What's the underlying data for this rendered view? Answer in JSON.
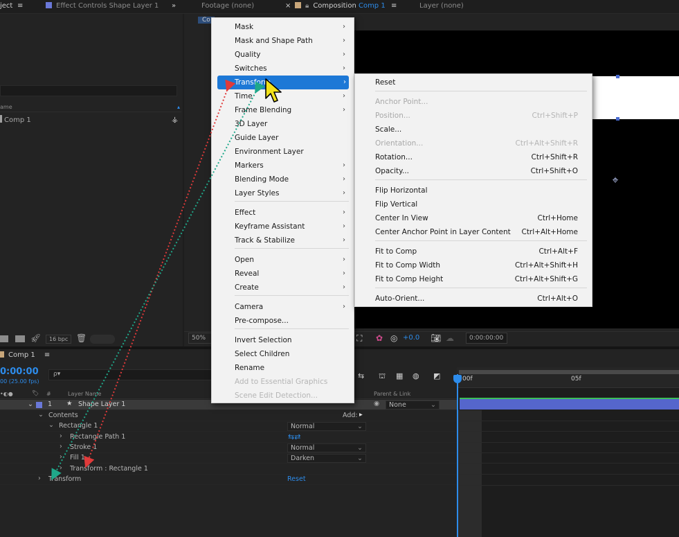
{
  "tabs": {
    "project": "ject",
    "effect_controls": "Effect Controls Shape Layer 1",
    "footage": "Footage (none)",
    "composition_prefix": "Composition",
    "composition_name": "Comp 1",
    "layer": "Layer (none)",
    "menu_glyph": "≡",
    "expand_glyph": "»"
  },
  "project": {
    "column_name": "ame",
    "item": "Comp 1",
    "bpc": "16 bpc"
  },
  "viewer": {
    "zoom": "50%",
    "exposure": "+0.0",
    "timecode": "0:00:00:00",
    "tab_fragment": "Co"
  },
  "timeline": {
    "tab": "Comp 1",
    "time": "0:00:00",
    "fps": "00 (25.00 fps)",
    "search_icon_text": "ρ▾",
    "col_hash": "#",
    "col_layer_name": "Layer Name",
    "col_parent": "Parent & Link",
    "ruler_0f": "00f",
    "ruler_05f": "05f",
    "add_label": "Add:",
    "reset_label": "Reset",
    "rows": [
      {
        "num": "1",
        "name": "Shape Layer 1",
        "parent": "None"
      },
      {
        "name": "Contents"
      },
      {
        "name": "Rectangle 1",
        "mode": "Normal"
      },
      {
        "name": "Rectangle Path 1"
      },
      {
        "name": "Stroke 1",
        "mode": "Normal"
      },
      {
        "name": "Fill 1",
        "mode": "Darken"
      },
      {
        "name": "Transform : Rectangle 1"
      },
      {
        "name": "Transform"
      }
    ]
  },
  "context_menu": {
    "items": [
      {
        "label": "Mask",
        "arrow": true
      },
      {
        "label": "Mask and Shape Path",
        "arrow": true
      },
      {
        "label": "Quality",
        "arrow": true
      },
      {
        "label": "Switches",
        "arrow": true
      },
      {
        "label": "Transform",
        "arrow": true,
        "selected": true
      },
      {
        "label": "Time",
        "arrow": true
      },
      {
        "label": "Frame Blending",
        "arrow": true
      },
      {
        "label": "3D Layer"
      },
      {
        "label": "Guide Layer"
      },
      {
        "label": "Environment Layer"
      },
      {
        "label": "Markers",
        "arrow": true
      },
      {
        "label": "Blending Mode",
        "arrow": true
      },
      {
        "label": "Layer Styles",
        "arrow": true
      },
      {
        "label": "Effect",
        "arrow": true
      },
      {
        "label": "Keyframe Assistant",
        "arrow": true
      },
      {
        "label": "Track & Stabilize",
        "arrow": true
      },
      {
        "label": "Open",
        "arrow": true
      },
      {
        "label": "Reveal",
        "arrow": true
      },
      {
        "label": "Create",
        "arrow": true
      },
      {
        "label": "Camera",
        "arrow": true
      },
      {
        "label": "Pre-compose..."
      },
      {
        "label": "Invert Selection"
      },
      {
        "label": "Select Children"
      },
      {
        "label": "Rename"
      },
      {
        "label": "Add to Essential Graphics",
        "disabled": true
      },
      {
        "label": "Scene Edit Detection...",
        "disabled": true
      }
    ],
    "arrow_glyph": "›"
  },
  "transform_submenu": {
    "items": [
      {
        "label": "Reset",
        "shortcut": ""
      },
      {
        "label": "Anchor Point...",
        "shortcut": "",
        "disabled": true
      },
      {
        "label": "Position...",
        "shortcut": "Ctrl+Shift+P",
        "disabled": true
      },
      {
        "label": "Scale...",
        "shortcut": ""
      },
      {
        "label": "Orientation...",
        "shortcut": "Ctrl+Alt+Shift+R",
        "disabled": true
      },
      {
        "label": "Rotation...",
        "shortcut": "Ctrl+Shift+R"
      },
      {
        "label": "Opacity...",
        "shortcut": "Ctrl+Shift+O"
      },
      {
        "label": "Flip Horizontal",
        "shortcut": ""
      },
      {
        "label": "Flip Vertical",
        "shortcut": ""
      },
      {
        "label": "Center In View",
        "shortcut": "Ctrl+Home"
      },
      {
        "label": "Center Anchor Point in Layer Content",
        "shortcut": "Ctrl+Alt+Home"
      },
      {
        "label": "Fit to Comp",
        "shortcut": "Ctrl+Alt+F"
      },
      {
        "label": "Fit to Comp Width",
        "shortcut": "Ctrl+Alt+Shift+H"
      },
      {
        "label": "Fit to Comp Height",
        "shortcut": "Ctrl+Alt+Shift+G"
      },
      {
        "label": "Auto-Orient...",
        "shortcut": "Ctrl+Alt+O"
      }
    ]
  },
  "colors": {
    "accent_blue": "#2d8ceb",
    "menu_selected": "#1d78d6",
    "layer_bar": "#5566cc",
    "annotation_red": "#e03a3a",
    "annotation_green": "#1fa88a"
  }
}
